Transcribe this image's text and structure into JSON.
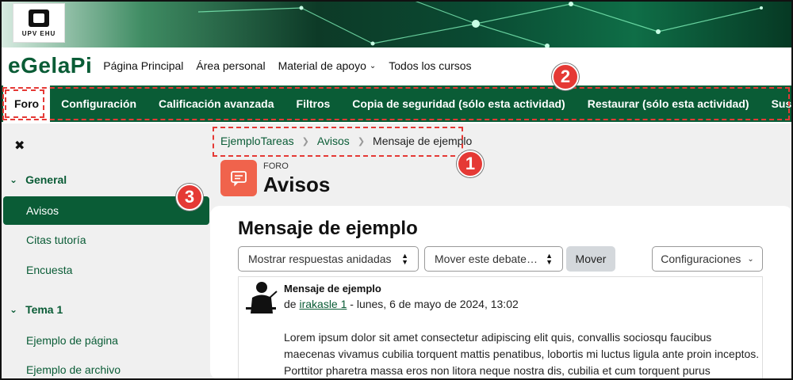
{
  "brand": {
    "logo_text": "UPV EHU",
    "name": "eGelaPi"
  },
  "nav": {
    "items": [
      "Página Principal",
      "Área personal",
      "Material de apoyo",
      "Todos los cursos"
    ]
  },
  "secondary_nav": {
    "tabs": [
      "Foro",
      "Configuración",
      "Calificación avanzada",
      "Filtros",
      "Copia de seguridad (sólo esta actividad)",
      "Restaurar (sólo esta actividad)",
      "Suscripciones"
    ]
  },
  "badges": {
    "one": "1",
    "two": "2",
    "three": "3"
  },
  "sidebar": {
    "close_icon": "✖",
    "section1": "General",
    "items1": [
      "Avisos",
      "Citas tutoría",
      "Encuesta"
    ],
    "section2": "Tema 1",
    "items2": [
      "Ejemplo de página",
      "Ejemplo de archivo"
    ]
  },
  "breadcrumb": {
    "items": [
      "EjemploTareas",
      "Avisos"
    ],
    "current": "Mensaje de ejemplo"
  },
  "forum": {
    "kind": "FORO",
    "title": "Avisos"
  },
  "discussion": {
    "heading": "Mensaje de ejemplo",
    "display_select": "Mostrar respuestas anidadas",
    "move_select": "Mover este debate a...",
    "move_button": "Mover",
    "settings_button": "Configuraciones"
  },
  "post": {
    "subject": "Mensaje de ejemplo",
    "by": "de",
    "author": "irakasle 1",
    "date": " - lunes, 6 de mayo de 2024, 13:02",
    "body": "Lorem ipsum dolor sit amet consectetur adipiscing elit quis, convallis sociosqu faucibus maecenas vivamus cubilia torquent mattis penatibus, lobortis mi luctus ligula ante proin inceptos. Porttitor pharetra massa eros non litora neque nostra dis, cubilia et cum torquent purus"
  },
  "colors": {
    "brand_green": "#0a5c36",
    "badge_red": "#e53935",
    "forum_icon": "#f0634c"
  }
}
